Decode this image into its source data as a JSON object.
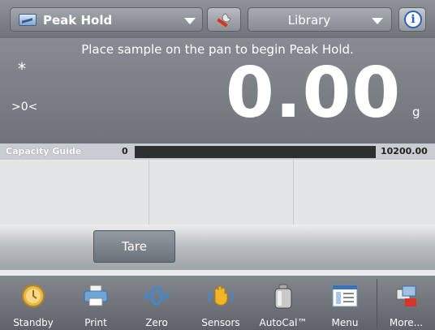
{
  "header": {
    "mode_label": "Peak Hold",
    "library_label": "Library",
    "info_glyph": "i",
    "icons": {
      "mode": "app-mode-icon",
      "tools": "wrench-icon",
      "info": "info-icon",
      "dropdown": "chevron-down-icon"
    }
  },
  "display": {
    "prompt": "Place sample on the pan to begin Peak Hold.",
    "stable_indicator": "*",
    "center_zero_indicator": ">0<",
    "weight": "0.00",
    "unit": "g"
  },
  "capacity_guide": {
    "label": "Capacity Guide",
    "min": "0",
    "max": "10200.00",
    "fill_fraction": 0
  },
  "actions": {
    "tare_label": "Tare"
  },
  "nav": {
    "items": [
      {
        "label": "Standby",
        "icon": "clock-icon"
      },
      {
        "label": "Print",
        "icon": "printer-icon"
      },
      {
        "label": "Zero",
        "icon": "zero-icon"
      },
      {
        "label": "Sensors",
        "icon": "hand-sensor-icon"
      },
      {
        "label": "AutoCal™",
        "icon": "calibration-weight-icon"
      },
      {
        "label": "Menu",
        "icon": "menu-icon"
      },
      {
        "label": "More...",
        "icon": "more-icon"
      }
    ]
  },
  "colors": {
    "accent_blue": "#2a62b8",
    "bar_fill": "#5bb6e8",
    "bar_track": "#2e2f31"
  }
}
